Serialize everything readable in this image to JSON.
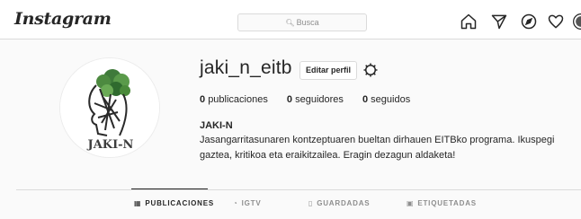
{
  "header": {
    "logo": "Instagram",
    "search_placeholder": "Busca",
    "nav_icons": [
      "home-icon",
      "direct-icon",
      "explore-icon",
      "activity-icon",
      "profile-avatar"
    ]
  },
  "profile": {
    "username": "jaki_n_eitb",
    "edit_button": "Editar perfil",
    "stats": [
      {
        "count": "0",
        "label": "publicaciones"
      },
      {
        "count": "0",
        "label": "seguidores"
      },
      {
        "count": "0",
        "label": "seguidos"
      }
    ],
    "full_name": "JAKI-N",
    "bio": "Jasangarritasunaren kontzeptuaren bueltan dirhauen EITBko programa. Ikuspegi gaztea, kritikoa eta eraikitzailea. Eragin dezagun aldaketa!",
    "avatar_text": "JAKI-N"
  },
  "tabs": [
    {
      "label": "PUBLICACIONES",
      "icon": "grid-icon",
      "active": true
    },
    {
      "label": "IGTV",
      "icon": "igtv-icon",
      "active": false
    },
    {
      "label": "GUARDADAS",
      "icon": "bookmark-icon",
      "active": false
    },
    {
      "label": "ETIQUETADAS",
      "icon": "tag-icon",
      "active": false
    }
  ],
  "colors": {
    "background": "#fafafa",
    "border": "#dbdbdb",
    "text": "#262626",
    "muted": "#8e8e8e"
  }
}
